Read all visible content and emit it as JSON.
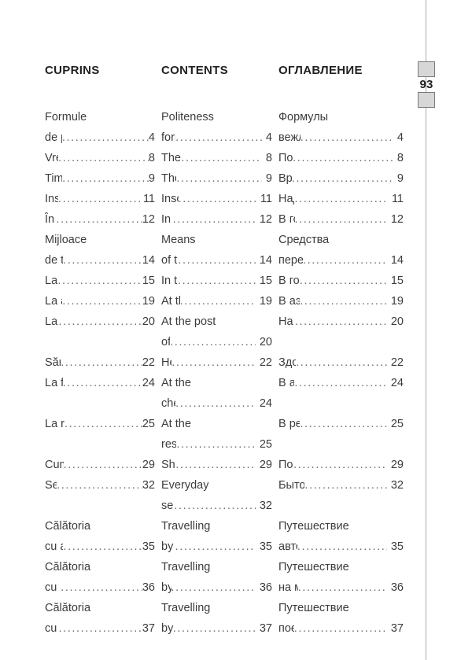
{
  "page_marker": {
    "number": "93"
  },
  "columns": [
    {
      "heading": "CUPRINS",
      "language": "romanian",
      "entries": [
        {
          "lines": [
            "Formule",
            "de politeţe"
          ],
          "page": "4"
        },
        {
          "lines": [
            "Vremea"
          ],
          "page": "8"
        },
        {
          "lines": [
            "Timpul/ora"
          ],
          "page": "9"
        },
        {
          "lines": [
            "Inscripţii"
          ],
          "page": "11"
        },
        {
          "lines": [
            "În oraş"
          ],
          "page": "12"
        },
        {
          "lines": [
            "Mijloace",
            "de transport"
          ],
          "page": "14"
        },
        {
          "lines": [
            "La hotel"
          ],
          "page": "15"
        },
        {
          "lines": [
            "La aeroport"
          ],
          "page": "19"
        },
        {
          "lines": [
            "La poştă"
          ],
          "page": "20"
        },
        {
          "lines": [
            "Sănătatea"
          ],
          "page": "22"
        },
        {
          "lines": [
            "La farmacie"
          ],
          "page": "24"
        },
        {
          "lines": [
            "La restaurant"
          ],
          "page": "25"
        },
        {
          "lines": [
            "Cumpărături"
          ],
          "page": "29"
        },
        {
          "lines": [
            "Servicii"
          ],
          "page": "32"
        },
        {
          "lines": [
            "Călătoria",
            "cu autocarul"
          ],
          "page": "35"
        },
        {
          "lines": [
            "Călătoria",
            "cu maşina"
          ],
          "page": "36"
        },
        {
          "lines": [
            "Călătoria",
            "cu trenul"
          ],
          "page": "37"
        }
      ]
    },
    {
      "heading": "CONTENTS",
      "language": "english",
      "entries": [
        {
          "lines": [
            "Politeness",
            "formulas"
          ],
          "page": "4"
        },
        {
          "lines": [
            "The Weather"
          ],
          "page": "8"
        },
        {
          "lines": [
            "The Time"
          ],
          "page": "9"
        },
        {
          "lines": [
            "Inscriptions"
          ],
          "page": "11"
        },
        {
          "lines": [
            "In town"
          ],
          "page": "12"
        },
        {
          "lines": [
            "Means",
            "of transport"
          ],
          "page": "14"
        },
        {
          "lines": [
            "In the hotel"
          ],
          "page": "15"
        },
        {
          "lines": [
            "At the airport"
          ],
          "page": "19"
        },
        {
          "lines": [
            "At the post",
            "office"
          ],
          "page": "20"
        },
        {
          "lines": [
            "Health"
          ],
          "page": "22"
        },
        {
          "lines": [
            "At the",
            "chemist's"
          ],
          "page": "24"
        },
        {
          "lines": [
            "At the",
            "restaurant"
          ],
          "page": "25"
        },
        {
          "lines": [
            "Shopping"
          ],
          "page": "29"
        },
        {
          "lines": [
            "Everyday",
            "services"
          ],
          "page": "32"
        },
        {
          "lines": [
            "Travelling",
            "by coach"
          ],
          "page": "35"
        },
        {
          "lines": [
            "Travelling",
            "by car"
          ],
          "page": "36"
        },
        {
          "lines": [
            "Travelling",
            "by train"
          ],
          "page": "37"
        }
      ]
    },
    {
      "heading": "ОГЛАВЛЕНИЕ",
      "language": "russian",
      "entries": [
        {
          "lines": [
            "Формулы",
            "вежливости"
          ],
          "page": "4"
        },
        {
          "lines": [
            "Погода"
          ],
          "page": "8"
        },
        {
          "lines": [
            "Время"
          ],
          "page": "9"
        },
        {
          "lines": [
            "Надписи"
          ],
          "page": "11"
        },
        {
          "lines": [
            "В городе"
          ],
          "page": "12"
        },
        {
          "lines": [
            "Средства",
            "передвижения"
          ],
          "page": "14"
        },
        {
          "lines": [
            "В гостинице"
          ],
          "page": "15"
        },
        {
          "lines": [
            "В аэропорту"
          ],
          "page": "19"
        },
        {
          "lines": [
            "На почте"
          ],
          "page": "20"
        },
        {
          "lines": [
            "Здоровье"
          ],
          "page": "22"
        },
        {
          "lines": [
            "В аптеке"
          ],
          "page": "24"
        },
        {
          "lines": [
            "В ресторане"
          ],
          "page": "25"
        },
        {
          "lines": [
            "Покупки"
          ],
          "page": "29"
        },
        {
          "lines": [
            "Бытовые услуги"
          ],
          "page": "32"
        },
        {
          "lines": [
            "Путешествие",
            "автобусом"
          ],
          "page": "35"
        },
        {
          "lines": [
            "Путешествие",
            "на машине"
          ],
          "page": "36"
        },
        {
          "lines": [
            "Путешествие",
            "поездом"
          ],
          "page": "37"
        }
      ]
    }
  ],
  "row_grid": [
    {
      "kind": "text",
      "entry": 0,
      "line": 0
    },
    {
      "kind": "text",
      "entry": 0,
      "line": 1
    },
    {
      "kind": "text",
      "entry": 1,
      "line": 0
    },
    {
      "kind": "text",
      "entry": 2,
      "line": 0
    },
    {
      "kind": "text",
      "entry": 3,
      "line": 0
    },
    {
      "kind": "text",
      "entry": 4,
      "line": 0
    },
    {
      "kind": "text",
      "entry": 5,
      "line": 0
    },
    {
      "kind": "text",
      "entry": 5,
      "line": 1
    },
    {
      "kind": "text",
      "entry": 6,
      "line": 0
    },
    {
      "kind": "text",
      "entry": 7,
      "line": 0
    },
    {
      "kind": "text",
      "entry": 8,
      "line": 0
    },
    {
      "kind": "text",
      "entry": 8,
      "line": 1
    },
    {
      "kind": "text",
      "entry": 9,
      "line": 0
    },
    {
      "kind": "text",
      "entry": 10,
      "line": 0
    },
    {
      "kind": "text",
      "entry": 10,
      "line": 1
    },
    {
      "kind": "text",
      "entry": 11,
      "line": 0
    },
    {
      "kind": "text",
      "entry": 11,
      "line": 1
    },
    {
      "kind": "text",
      "entry": 12,
      "line": 0
    },
    {
      "kind": "text",
      "entry": 13,
      "line": 0
    },
    {
      "kind": "text",
      "entry": 13,
      "line": 1
    },
    {
      "kind": "text",
      "entry": 14,
      "line": 0
    },
    {
      "kind": "text",
      "entry": 14,
      "line": 1
    },
    {
      "kind": "text",
      "entry": 15,
      "line": 0
    },
    {
      "kind": "text",
      "entry": 15,
      "line": 1
    },
    {
      "kind": "text",
      "entry": 16,
      "line": 0
    },
    {
      "kind": "text",
      "entry": 16,
      "line": 1
    }
  ]
}
